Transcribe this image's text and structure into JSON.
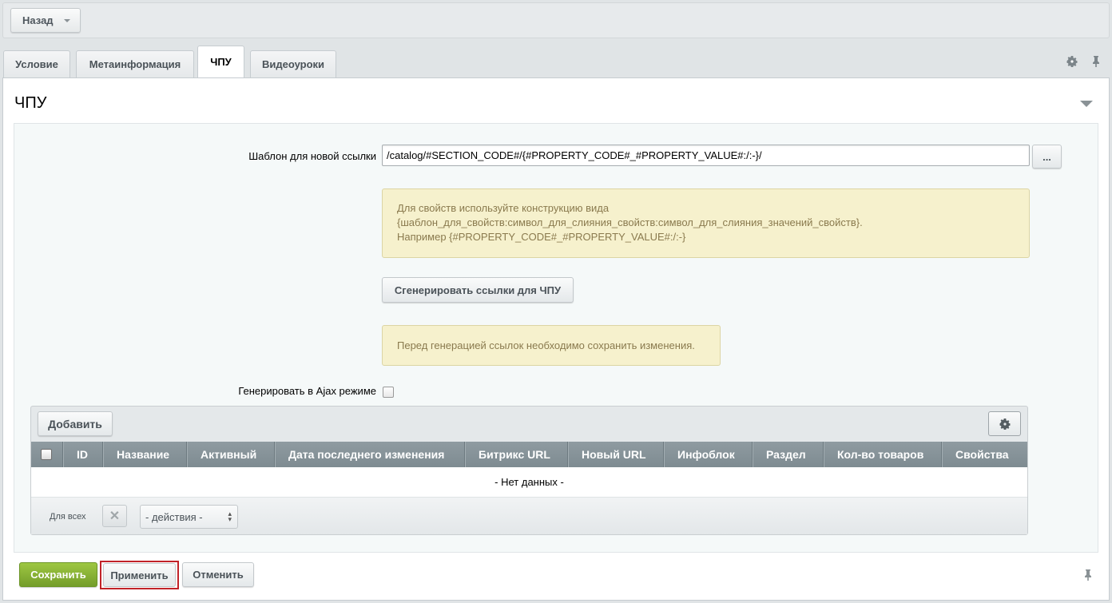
{
  "topbar": {
    "back_label": "Назад"
  },
  "tabs": [
    {
      "label": "Условие"
    },
    {
      "label": "Метаинформация"
    },
    {
      "label": "ЧПУ",
      "active": true
    },
    {
      "label": "Видеоуроки"
    }
  ],
  "tab_tools": {
    "settings_icon": "gear-icon",
    "pin_icon": "pin-icon"
  },
  "section": {
    "title": "ЧПУ"
  },
  "form": {
    "template_label": "Шаблон для новой ссылки",
    "template_value": "/catalog/#SECTION_CODE#/{#PROPERTY_CODE#_#PROPERTY_VALUE#:/:-}/",
    "dots_label": "...",
    "note1_lines": [
      "Для свойств используйте конструкцию вида",
      "{шаблон_для_свойств:символ_для_слияния_свойств:символ_для_слияния_значений_свойств}.",
      "Например {#PROPERTY_CODE#_#PROPERTY_VALUE#:/:-}"
    ],
    "generate_label": "Сгенерировать ссылки для ЧПУ",
    "note2": "Перед генерацией ссылок необходимо сохранить изменения.",
    "ajax_label": "Генерировать в Ajax режиме"
  },
  "grid": {
    "add_label": "Добавить",
    "columns": [
      "ID",
      "Название",
      "Активный",
      "Дата последнего изменения",
      "Битрикс URL",
      "Новый URL",
      "Инфоблок",
      "Раздел",
      "Кол-во товаров",
      "Свойства"
    ],
    "empty_text": "- Нет данных -",
    "for_all_label": "Для всех",
    "actions_value": "- действия -"
  },
  "buttons": {
    "save": "Сохранить",
    "apply": "Применить",
    "cancel": "Отменить"
  },
  "colors": {
    "save_green": "#8ab536",
    "highlight_red": "#c12228",
    "note_bg": "#f6f1cd"
  }
}
